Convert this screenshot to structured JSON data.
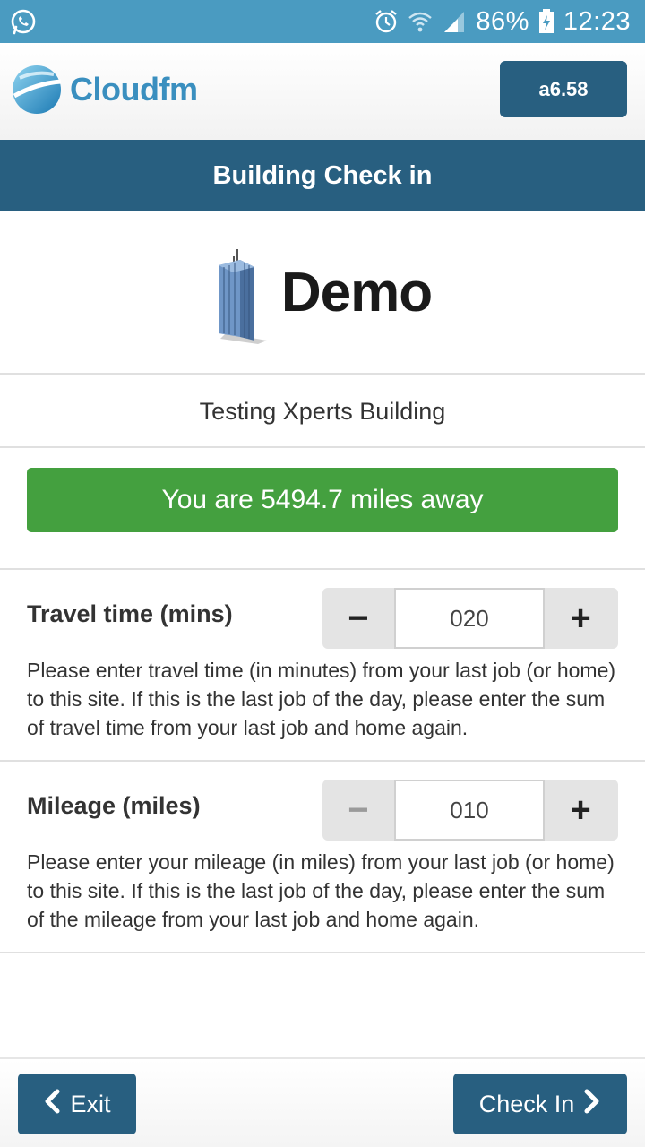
{
  "status_bar": {
    "battery": "86%",
    "time": "12:23",
    "icons": [
      "whatsapp-icon",
      "alarm-icon",
      "wifi-icon",
      "signal-icon",
      "battery-charging-icon"
    ]
  },
  "header": {
    "logo_text": "Cloudfm",
    "version_label": "a6.58"
  },
  "title": "Building Check in",
  "demo_logo_text": "Demo",
  "building_name": "Testing Xperts Building",
  "distance_text": "You are 5494.7 miles away",
  "fields": {
    "travel": {
      "label": "Travel time (mins)",
      "value": "020",
      "minus": "−",
      "plus": "+",
      "help": "Please enter travel time (in minutes) from your last job (or home) to this site. If this is the last job of the day, please enter the sum of travel time from your last job and home again."
    },
    "mileage": {
      "label": "Mileage (miles)",
      "value": "010",
      "minus": "−",
      "plus": "+",
      "help": "Please enter your mileage (in miles) from your last job (or home) to this site. If this is the last job of the day, please enter the sum of the mileage from your last job and home again."
    }
  },
  "bottom": {
    "exit_label": "Exit",
    "checkin_label": "Check In"
  },
  "colors": {
    "status_bar": "#4a9bc1",
    "primary": "#285f80",
    "success": "#44a03f"
  }
}
